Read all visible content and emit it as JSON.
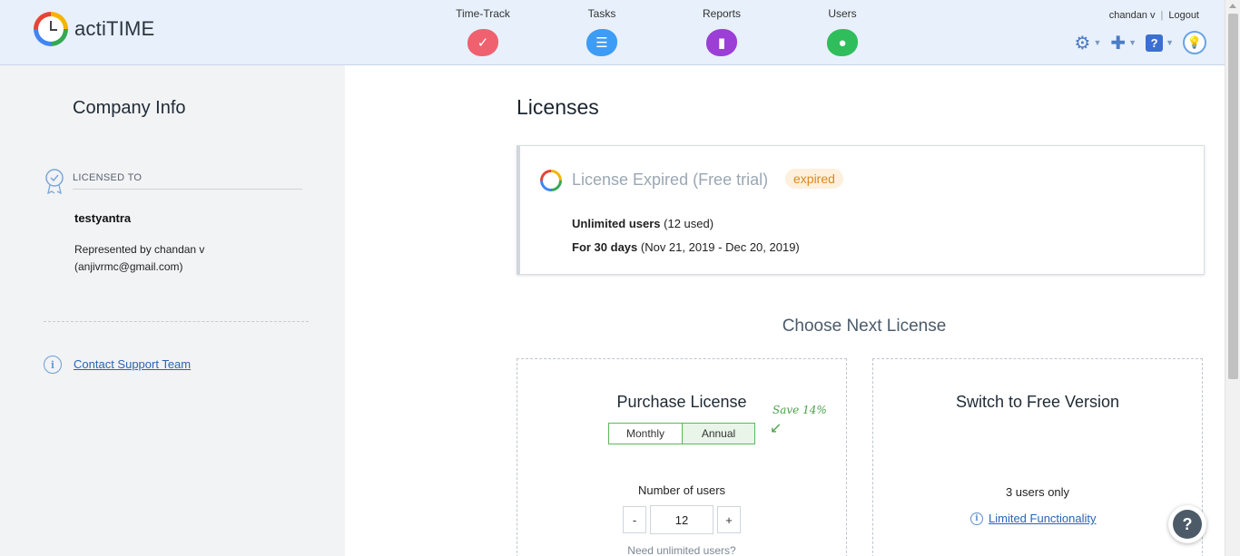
{
  "app": {
    "name": "actiTIME"
  },
  "header": {
    "nav": [
      {
        "label": "Time-Track",
        "icon": "check-icon"
      },
      {
        "label": "Tasks",
        "icon": "list-icon"
      },
      {
        "label": "Reports",
        "icon": "bar-chart-icon"
      },
      {
        "label": "Users",
        "icon": "user-icon"
      }
    ],
    "user_name": "chandan v",
    "separator": "|",
    "logout_label": "Logout",
    "tools": [
      "settings-icon",
      "puzzle-icon",
      "help-icon",
      "lightbulb-icon"
    ]
  },
  "sidebar": {
    "title": "Company Info",
    "licensed_label": "LICENSED TO",
    "company_name": "testyantra",
    "represented_line1": "Represented by chandan v",
    "represented_line2": "(anjivrmc@gmail.com)",
    "contact_label": "Contact Support Team"
  },
  "main": {
    "title": "Licenses",
    "license_card": {
      "title": "License Expired (Free trial)",
      "status_badge": "expired",
      "users_bold": "Unlimited users",
      "users_rest": " (12 used)",
      "period_bold": "For 30 days",
      "period_rest": " (Nov 21, 2019 - Dec 20, 2019)"
    },
    "choose_title": "Choose Next License",
    "purchase": {
      "title": "Purchase License",
      "toggle_monthly": "Monthly",
      "toggle_annual": "Annual",
      "selected": "Annual",
      "save_note": "Save 14%",
      "num_users_label": "Number of users",
      "minus": "-",
      "plus": "+",
      "users_value": "12",
      "need_unlimited": "Need unlimited users?"
    },
    "free": {
      "title": "Switch to Free Version",
      "users_only": "3 users only",
      "limited_link": "Limited Functionality"
    }
  },
  "help_fab": "?",
  "colors": {
    "header_bg": "#e7f0fb",
    "sidebar_bg": "#f2f3f5",
    "link": "#2766b5",
    "expired_text": "#d98a1e",
    "toggle_green": "#5cb85c"
  }
}
